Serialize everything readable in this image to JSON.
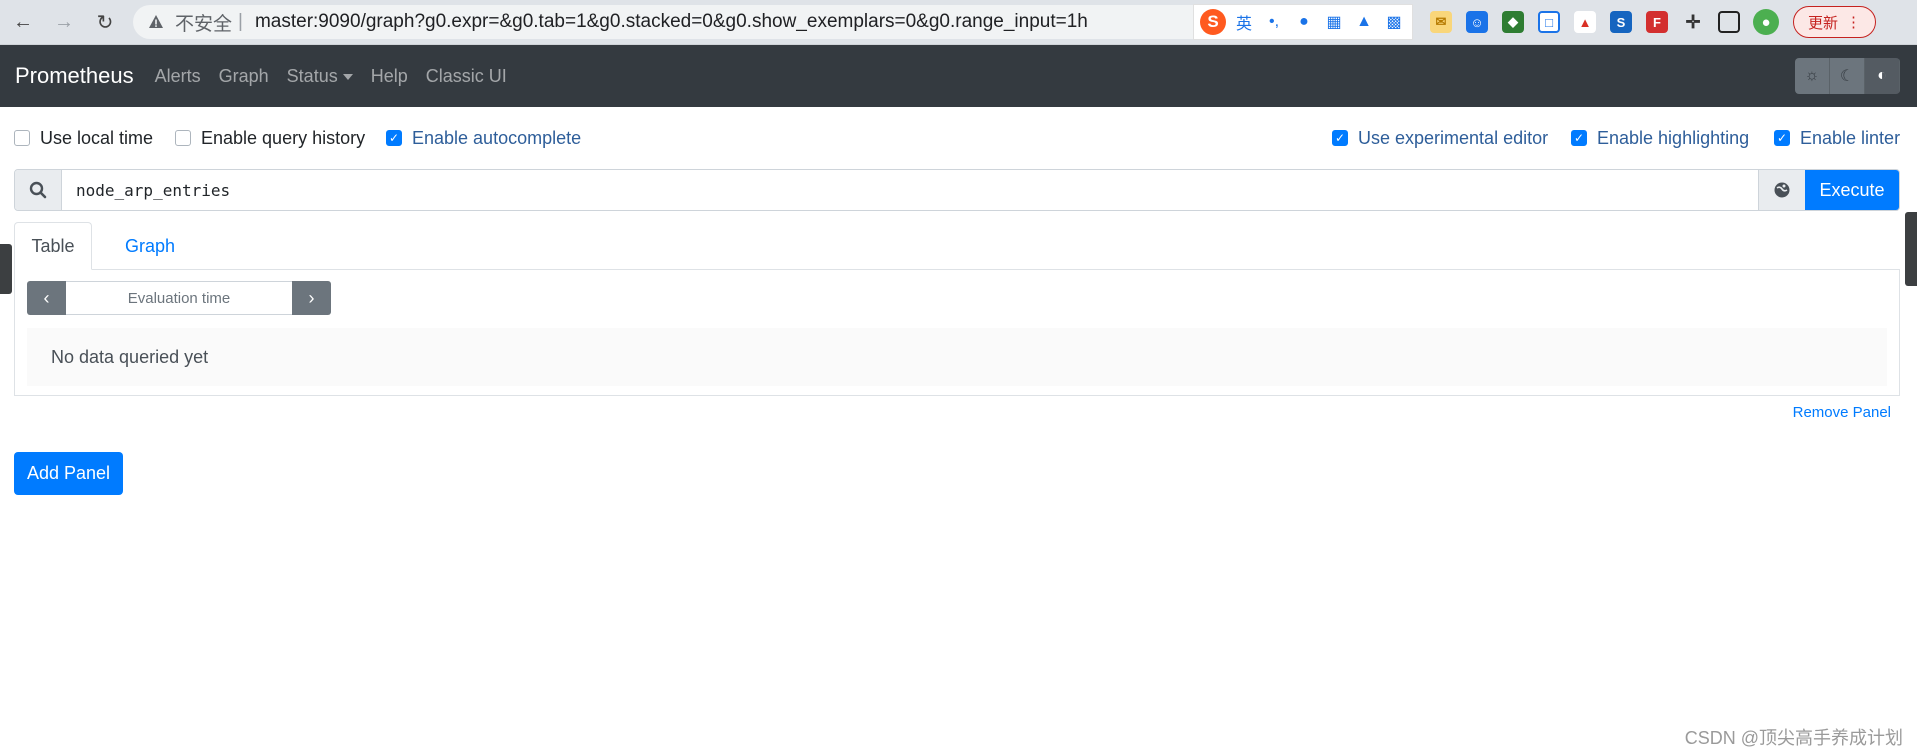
{
  "browser": {
    "insecure_label": "不安全",
    "separator": "|",
    "url": "master:9090/graph?g0.expr=&g0.tab=1&g0.stacked=0&g0.show_exemplars=0&g0.range_input=1h",
    "ime_lang": "英",
    "update_label": "更新"
  },
  "navbar": {
    "brand": "Prometheus",
    "links": [
      "Alerts",
      "Graph",
      "Status",
      "Help",
      "Classic UI"
    ]
  },
  "options": {
    "use_local_time": {
      "label": "Use local time",
      "checked": false
    },
    "enable_query_history": {
      "label": "Enable query history",
      "checked": false
    },
    "enable_autocomplete": {
      "label": "Enable autocomplete",
      "checked": true
    },
    "use_experimental_editor": {
      "label": "Use experimental editor",
      "checked": true
    },
    "enable_highlighting": {
      "label": "Enable highlighting",
      "checked": true
    },
    "enable_linter": {
      "label": "Enable linter",
      "checked": true
    }
  },
  "query": {
    "expression": "node_arp_entries",
    "execute_label": "Execute"
  },
  "panel": {
    "tabs": [
      "Table",
      "Graph"
    ],
    "eval_placeholder": "Evaluation time",
    "no_data": "No data queried yet",
    "remove_label": "Remove Panel"
  },
  "add_panel_label": "Add Panel",
  "watermark": "CSDN @顶尖高手养成计划",
  "colors": {
    "primary": "#007bff",
    "navbar": "#343a40"
  }
}
